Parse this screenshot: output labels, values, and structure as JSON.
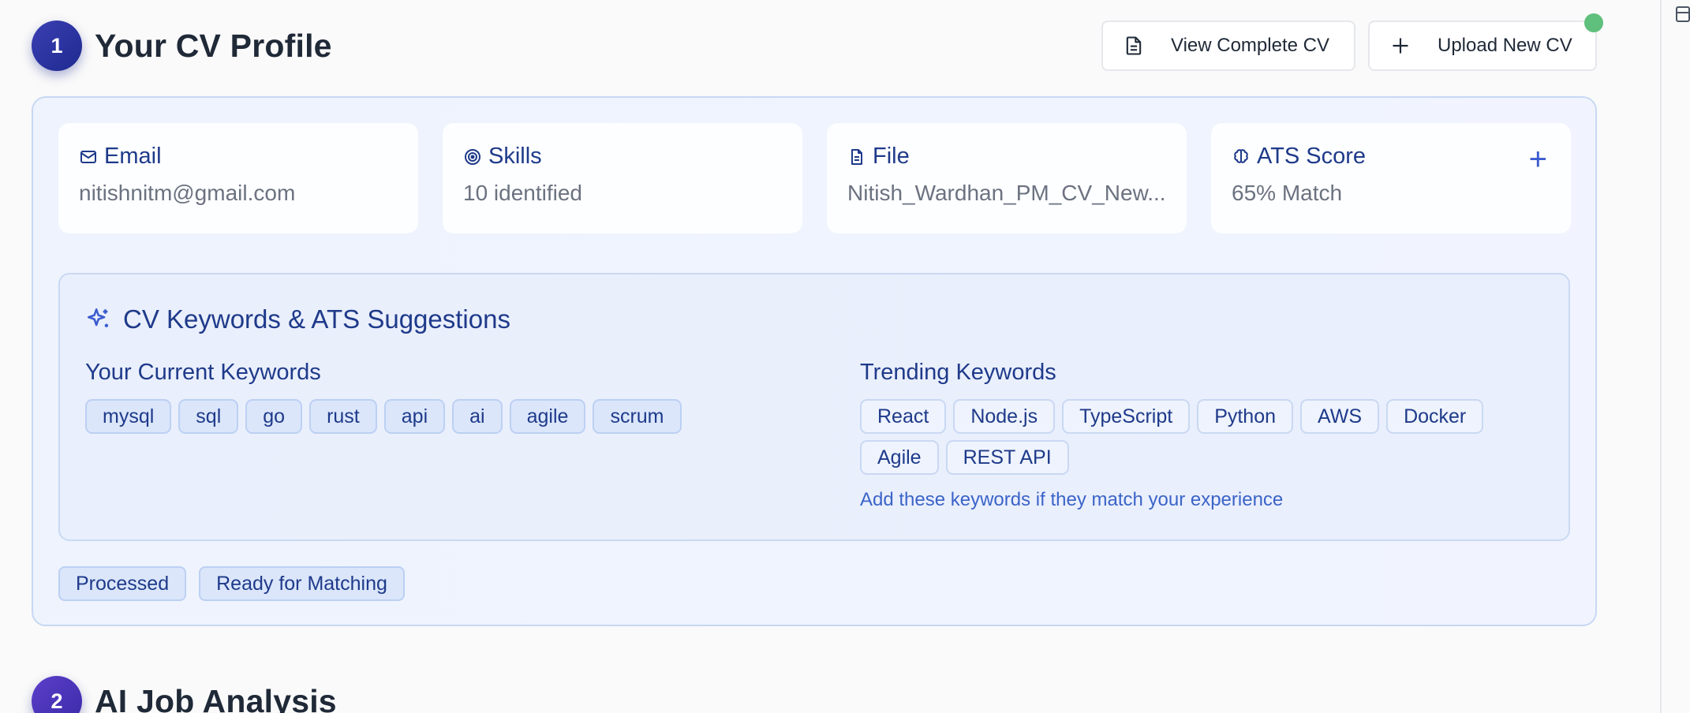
{
  "section1": {
    "step": "1",
    "title": "Your CV Profile"
  },
  "section2": {
    "step": "2",
    "title": "AI Job Analysis"
  },
  "toolbar": {
    "view_cv_label": "View Complete CV",
    "upload_cv_label": "Upload New CV"
  },
  "info_tiles": [
    {
      "label": "Email",
      "value": "nitishnitm@gmail.com",
      "icon": "mail-icon"
    },
    {
      "label": "Skills",
      "value": "10 identified",
      "icon": "target-icon"
    },
    {
      "label": "File",
      "value": "Nitish_Wardhan_PM_CV_New...",
      "icon": "file-icon"
    },
    {
      "label": "ATS Score",
      "value": "65% Match",
      "icon": "brain-icon"
    }
  ],
  "keywords": {
    "title": "CV Keywords & ATS Suggestions",
    "current_title": "Your Current Keywords",
    "current": [
      "mysql",
      "sql",
      "go",
      "rust",
      "api",
      "ai",
      "agile",
      "scrum"
    ],
    "trending_title": "Trending Keywords",
    "trending": [
      "React",
      "Node.js",
      "TypeScript",
      "Python",
      "AWS",
      "Docker",
      "Agile",
      "REST API"
    ],
    "hint": "Add these keywords if they match your experience"
  },
  "status_pills": [
    "Processed",
    "Ready for Matching"
  ],
  "colors": {
    "accent": "#1e3a8a",
    "badge": "#1e2a8f",
    "online_dot": "#5fbf7c"
  }
}
